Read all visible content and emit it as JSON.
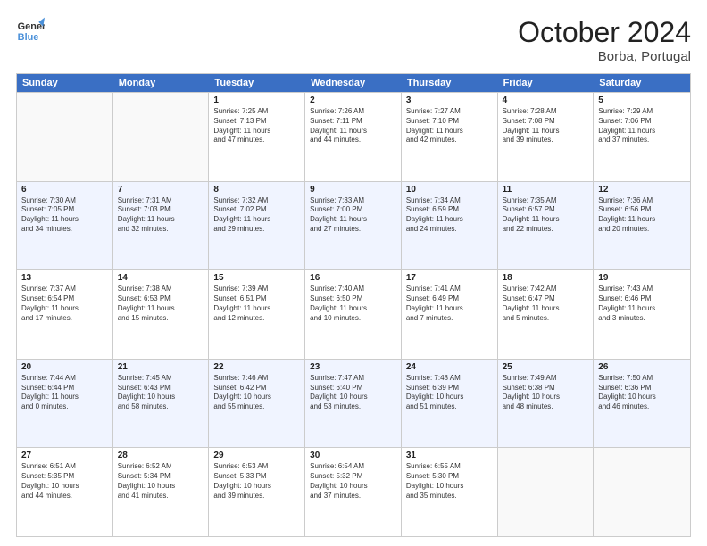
{
  "header": {
    "logo_line1": "General",
    "logo_line2": "Blue",
    "month": "October 2024",
    "location": "Borba, Portugal"
  },
  "weekdays": [
    "Sunday",
    "Monday",
    "Tuesday",
    "Wednesday",
    "Thursday",
    "Friday",
    "Saturday"
  ],
  "rows": [
    {
      "cells": [
        {
          "day": "",
          "empty": true
        },
        {
          "day": "",
          "empty": true
        },
        {
          "day": "1",
          "lines": [
            "Sunrise: 7:25 AM",
            "Sunset: 7:13 PM",
            "Daylight: 11 hours",
            "and 47 minutes."
          ]
        },
        {
          "day": "2",
          "lines": [
            "Sunrise: 7:26 AM",
            "Sunset: 7:11 PM",
            "Daylight: 11 hours",
            "and 44 minutes."
          ]
        },
        {
          "day": "3",
          "lines": [
            "Sunrise: 7:27 AM",
            "Sunset: 7:10 PM",
            "Daylight: 11 hours",
            "and 42 minutes."
          ]
        },
        {
          "day": "4",
          "lines": [
            "Sunrise: 7:28 AM",
            "Sunset: 7:08 PM",
            "Daylight: 11 hours",
            "and 39 minutes."
          ]
        },
        {
          "day": "5",
          "lines": [
            "Sunrise: 7:29 AM",
            "Sunset: 7:06 PM",
            "Daylight: 11 hours",
            "and 37 minutes."
          ]
        }
      ]
    },
    {
      "cells": [
        {
          "day": "6",
          "lines": [
            "Sunrise: 7:30 AM",
            "Sunset: 7:05 PM",
            "Daylight: 11 hours",
            "and 34 minutes."
          ]
        },
        {
          "day": "7",
          "lines": [
            "Sunrise: 7:31 AM",
            "Sunset: 7:03 PM",
            "Daylight: 11 hours",
            "and 32 minutes."
          ]
        },
        {
          "day": "8",
          "lines": [
            "Sunrise: 7:32 AM",
            "Sunset: 7:02 PM",
            "Daylight: 11 hours",
            "and 29 minutes."
          ]
        },
        {
          "day": "9",
          "lines": [
            "Sunrise: 7:33 AM",
            "Sunset: 7:00 PM",
            "Daylight: 11 hours",
            "and 27 minutes."
          ]
        },
        {
          "day": "10",
          "lines": [
            "Sunrise: 7:34 AM",
            "Sunset: 6:59 PM",
            "Daylight: 11 hours",
            "and 24 minutes."
          ]
        },
        {
          "day": "11",
          "lines": [
            "Sunrise: 7:35 AM",
            "Sunset: 6:57 PM",
            "Daylight: 11 hours",
            "and 22 minutes."
          ]
        },
        {
          "day": "12",
          "lines": [
            "Sunrise: 7:36 AM",
            "Sunset: 6:56 PM",
            "Daylight: 11 hours",
            "and 20 minutes."
          ]
        }
      ]
    },
    {
      "cells": [
        {
          "day": "13",
          "lines": [
            "Sunrise: 7:37 AM",
            "Sunset: 6:54 PM",
            "Daylight: 11 hours",
            "and 17 minutes."
          ]
        },
        {
          "day": "14",
          "lines": [
            "Sunrise: 7:38 AM",
            "Sunset: 6:53 PM",
            "Daylight: 11 hours",
            "and 15 minutes."
          ]
        },
        {
          "day": "15",
          "lines": [
            "Sunrise: 7:39 AM",
            "Sunset: 6:51 PM",
            "Daylight: 11 hours",
            "and 12 minutes."
          ]
        },
        {
          "day": "16",
          "lines": [
            "Sunrise: 7:40 AM",
            "Sunset: 6:50 PM",
            "Daylight: 11 hours",
            "and 10 minutes."
          ]
        },
        {
          "day": "17",
          "lines": [
            "Sunrise: 7:41 AM",
            "Sunset: 6:49 PM",
            "Daylight: 11 hours",
            "and 7 minutes."
          ]
        },
        {
          "day": "18",
          "lines": [
            "Sunrise: 7:42 AM",
            "Sunset: 6:47 PM",
            "Daylight: 11 hours",
            "and 5 minutes."
          ]
        },
        {
          "day": "19",
          "lines": [
            "Sunrise: 7:43 AM",
            "Sunset: 6:46 PM",
            "Daylight: 11 hours",
            "and 3 minutes."
          ]
        }
      ]
    },
    {
      "cells": [
        {
          "day": "20",
          "lines": [
            "Sunrise: 7:44 AM",
            "Sunset: 6:44 PM",
            "Daylight: 11 hours",
            "and 0 minutes."
          ]
        },
        {
          "day": "21",
          "lines": [
            "Sunrise: 7:45 AM",
            "Sunset: 6:43 PM",
            "Daylight: 10 hours",
            "and 58 minutes."
          ]
        },
        {
          "day": "22",
          "lines": [
            "Sunrise: 7:46 AM",
            "Sunset: 6:42 PM",
            "Daylight: 10 hours",
            "and 55 minutes."
          ]
        },
        {
          "day": "23",
          "lines": [
            "Sunrise: 7:47 AM",
            "Sunset: 6:40 PM",
            "Daylight: 10 hours",
            "and 53 minutes."
          ]
        },
        {
          "day": "24",
          "lines": [
            "Sunrise: 7:48 AM",
            "Sunset: 6:39 PM",
            "Daylight: 10 hours",
            "and 51 minutes."
          ]
        },
        {
          "day": "25",
          "lines": [
            "Sunrise: 7:49 AM",
            "Sunset: 6:38 PM",
            "Daylight: 10 hours",
            "and 48 minutes."
          ]
        },
        {
          "day": "26",
          "lines": [
            "Sunrise: 7:50 AM",
            "Sunset: 6:36 PM",
            "Daylight: 10 hours",
            "and 46 minutes."
          ]
        }
      ]
    },
    {
      "cells": [
        {
          "day": "27",
          "lines": [
            "Sunrise: 6:51 AM",
            "Sunset: 5:35 PM",
            "Daylight: 10 hours",
            "and 44 minutes."
          ]
        },
        {
          "day": "28",
          "lines": [
            "Sunrise: 6:52 AM",
            "Sunset: 5:34 PM",
            "Daylight: 10 hours",
            "and 41 minutes."
          ]
        },
        {
          "day": "29",
          "lines": [
            "Sunrise: 6:53 AM",
            "Sunset: 5:33 PM",
            "Daylight: 10 hours",
            "and 39 minutes."
          ]
        },
        {
          "day": "30",
          "lines": [
            "Sunrise: 6:54 AM",
            "Sunset: 5:32 PM",
            "Daylight: 10 hours",
            "and 37 minutes."
          ]
        },
        {
          "day": "31",
          "lines": [
            "Sunrise: 6:55 AM",
            "Sunset: 5:30 PM",
            "Daylight: 10 hours",
            "and 35 minutes."
          ]
        },
        {
          "day": "",
          "empty": true
        },
        {
          "day": "",
          "empty": true
        }
      ]
    }
  ]
}
